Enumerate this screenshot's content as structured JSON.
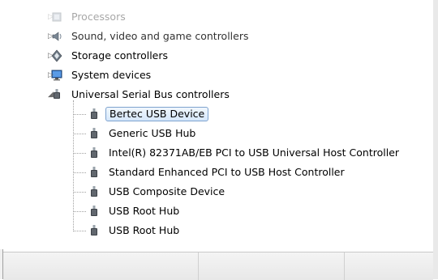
{
  "tree": {
    "categories": [
      {
        "label": "Processors",
        "icon": "processor-icon",
        "expanded": false,
        "dimmed": true
      },
      {
        "label": "Sound, video and game controllers",
        "icon": "speaker-icon",
        "expanded": false,
        "dimmed": false
      },
      {
        "label": "Storage controllers",
        "icon": "storage-icon",
        "expanded": false,
        "dimmed": false
      },
      {
        "label": "System devices",
        "icon": "monitor-icon",
        "expanded": false,
        "dimmed": false
      },
      {
        "label": "Universal Serial Bus controllers",
        "icon": "usb-icon",
        "expanded": true,
        "dimmed": false
      }
    ],
    "usb_children": [
      {
        "label": "Bertec USB Device",
        "selected": true
      },
      {
        "label": "Generic USB Hub",
        "selected": false
      },
      {
        "label": "Intel(R) 82371AB/EB PCI to USB Universal Host Controller",
        "selected": false
      },
      {
        "label": "Standard Enhanced PCI to USB Host Controller",
        "selected": false
      },
      {
        "label": "USB Composite Device",
        "selected": false
      },
      {
        "label": "USB Root Hub",
        "selected": false
      },
      {
        "label": "USB Root Hub",
        "selected": false
      }
    ]
  },
  "colors": {
    "selection_border": "#7da2ce",
    "selection_fill": "#d6e8fb"
  }
}
